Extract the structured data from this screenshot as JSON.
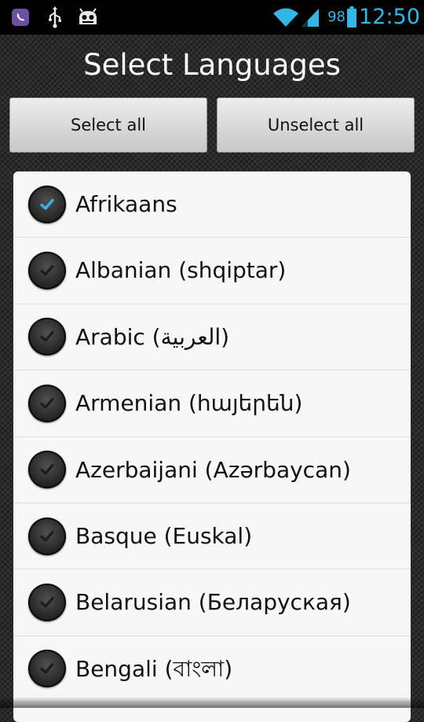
{
  "status_bar": {
    "icons": [
      "viber-icon",
      "usb-icon",
      "android-debug-icon",
      "wifi-icon",
      "signal-icon",
      "battery-icon"
    ],
    "battery_level": "98",
    "time": "12:50"
  },
  "title": "Select Languages",
  "buttons": {
    "select_all": "Select all",
    "unselect_all": "Unselect all"
  },
  "languages": [
    {
      "label": "Afrikaans",
      "checked": true
    },
    {
      "label": "Albanian (shqiptar)",
      "checked": false
    },
    {
      "label": "Arabic (العربية)",
      "checked": false
    },
    {
      "label": "Armenian (հայերեն)",
      "checked": false
    },
    {
      "label": "Azerbaijani (Azərbaycan)",
      "checked": false
    },
    {
      "label": "Basque (Euskal)",
      "checked": false
    },
    {
      "label": "Belarusian (Беларуская)",
      "checked": false
    },
    {
      "label": "Bengali (বাংলা)",
      "checked": false
    }
  ],
  "colors": {
    "accent": "#33b5e5",
    "check_on": "#33b5e5",
    "check_off": "#1a1a1a",
    "list_background": "#f7f7f7"
  }
}
